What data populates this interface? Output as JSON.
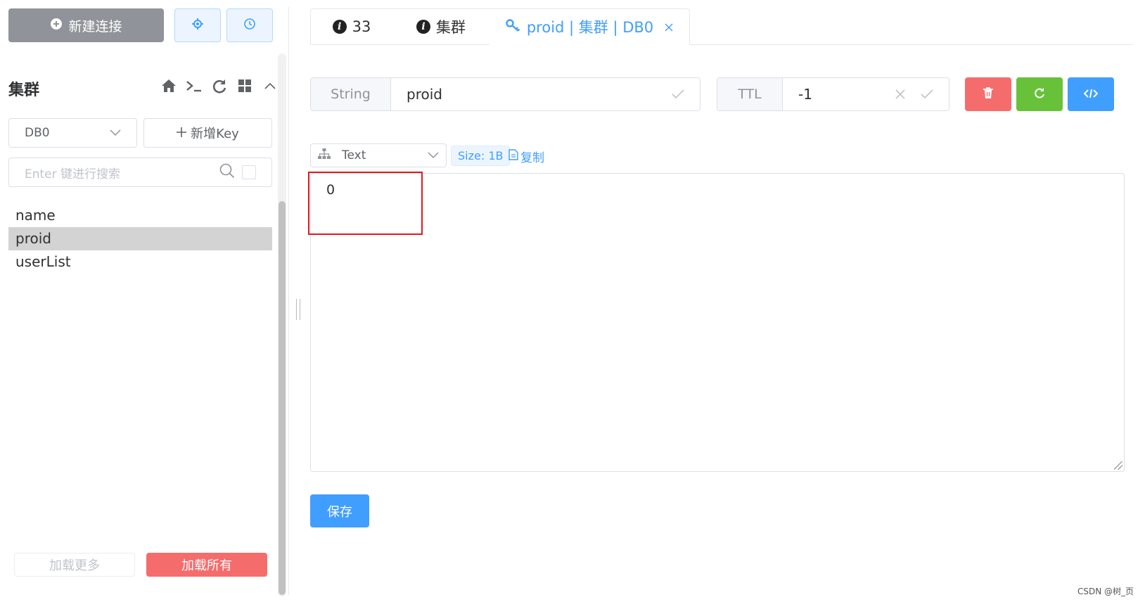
{
  "sidebar": {
    "new_connection_label": "新建连接",
    "title": "集群",
    "db_select_value": "DB0",
    "add_key_label": "新增Key",
    "search_placeholder": "Enter 键进行搜索",
    "keys": [
      "name",
      "proid",
      "userList"
    ],
    "selected_key": "proid",
    "load_more_label": "加载更多",
    "load_all_label": "加载所有"
  },
  "tabs": [
    {
      "label": "33",
      "icon": "info-icon"
    },
    {
      "label": "集群",
      "icon": "info-icon"
    },
    {
      "label": "proid | 集群 | DB0",
      "icon": "key-icon",
      "active": true
    }
  ],
  "key_panel": {
    "type_label": "String",
    "key_name": "proid",
    "ttl_label": "TTL",
    "ttl_value": "-1"
  },
  "viewer": {
    "format_value": "Text",
    "size_tag": "Size: 1B",
    "copy_label": "复制",
    "content": "0",
    "save_label": "保存"
  },
  "watermark": "CSDN @树_页",
  "colors": {
    "primary": "#409eff",
    "danger": "#f56c6c",
    "success": "#67c23a",
    "info": "#909399",
    "highlight_box": "#e0191f"
  }
}
